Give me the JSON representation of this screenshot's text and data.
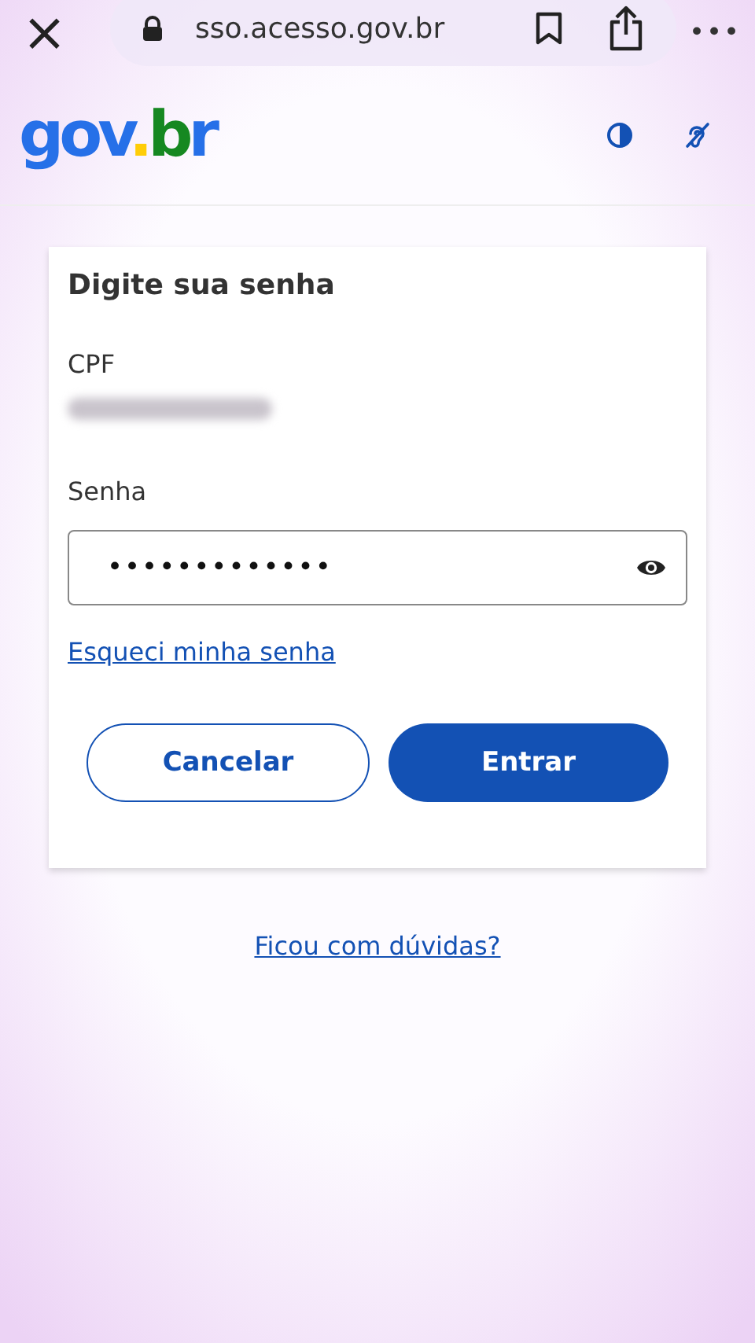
{
  "browser_bar": {
    "close": "×",
    "url": "sso.acesso.gov.br",
    "more": "•••"
  },
  "header": {
    "logo": "gov.br"
  },
  "card": {
    "title": "Digite sua senha",
    "cpf_label": "CPF",
    "cpf_redacted": true,
    "password_label": "Senha",
    "password_value": "•••••••••••••",
    "forgot_link": "Esqueci minha senha",
    "buttons": [
      {
        "label": "Cancelar",
        "kind": "secondary"
      },
      {
        "label": "Entrar",
        "kind": "primary"
      }
    ]
  },
  "help_link": "Ficou com dúvidas?"
}
